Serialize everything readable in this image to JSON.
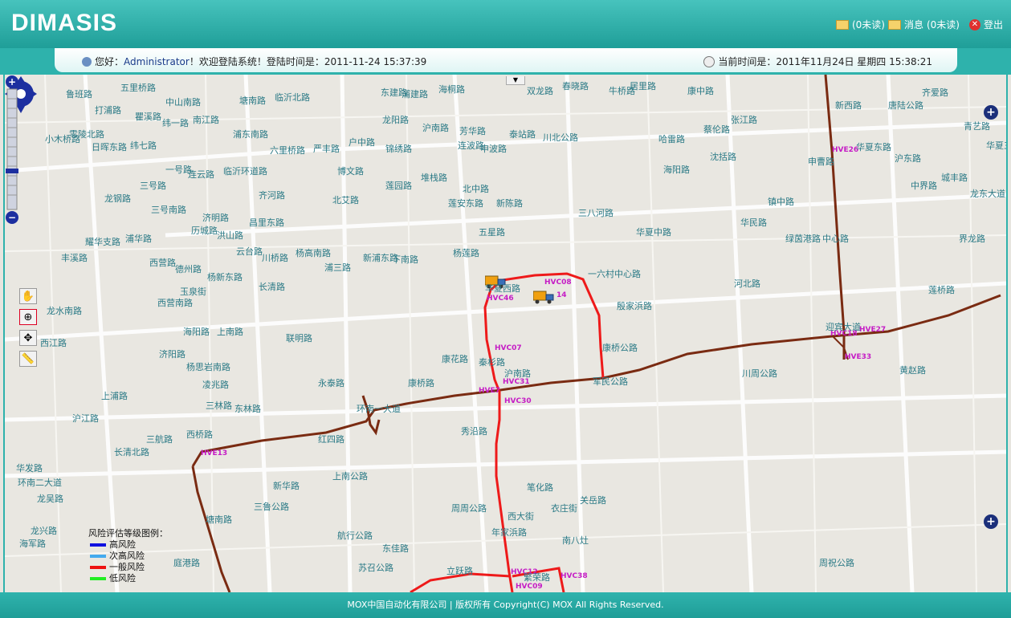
{
  "header": {
    "logo": "DIMASIS",
    "mail_unread": "(0未读)",
    "message_label": "消息",
    "message_unread": "(0未读)",
    "logout": "登出"
  },
  "info": {
    "greeting": "您好：",
    "user": "Administrator",
    "welcome": "！欢迎登陆系统！登陆时间是：",
    "login_time": "2011-11-24 15:37:39",
    "current_label": "当前时间是：",
    "current_time": "2011年11月24日 星期四 15:38:21"
  },
  "legend": {
    "title": "风险评估等级图例：",
    "items": [
      {
        "label": "高风险",
        "color": "#1010e0"
      },
      {
        "label": "次高风险",
        "color": "#44aaee"
      },
      {
        "label": "一般风险",
        "color": "#ee1111"
      },
      {
        "label": "低风险",
        "color": "#22ee22"
      }
    ]
  },
  "colors": {
    "route_brown": "#7a2b12",
    "route_red": "#ee1a1a",
    "station_pink": "#c51cc5"
  },
  "stations": {
    "s1": "HVC08",
    "s2": "HVC46",
    "s3": "14",
    "s4": "HVC07",
    "s5": "HVC31",
    "s6": "HVE7",
    "s7": "HVC30",
    "s8": "HVE26",
    "s9": "HVE27",
    "s10": "HVC18",
    "s11": "HVE33",
    "s12": "HVE13",
    "s13": "HVC12",
    "s14": "HVC38",
    "s15": "HVC09"
  },
  "roads": {
    "r1": "五里桥路",
    "r2": "中山南路",
    "r3": "纬一路",
    "r4": "南江路",
    "r5": "塘南路",
    "r6": "临沂北路",
    "r7": "浦建路",
    "r8": "龙阳路",
    "r9": "东建路",
    "r10": "海桐路",
    "r11": "芳华路",
    "r12": "春晓路",
    "r13": "双龙路",
    "r14": "牛桥路",
    "r15": "居里路",
    "r16": "康中路",
    "r17": "齐爱路",
    "r18": "新西路",
    "r19": "唐陆公路",
    "r20": "青艺路",
    "r21": "鲁班路",
    "r22": "打浦路",
    "r23": "瞿溪路",
    "r24": "纬七路",
    "r25": "浦东南路",
    "r26": "六里桥路",
    "r27": "严丰路",
    "r28": "户中路",
    "r29": "锦绣路",
    "r30": "沪南路",
    "r31": "连波路",
    "r32": "泰站路",
    "r33": "申波路",
    "r34": "川北公路",
    "r35": "哈雷路",
    "r36": "蔡伦路",
    "r37": "张江路",
    "r38": "华夏东路",
    "r39": "沪东路",
    "r40": "华夏三路",
    "r41": "日晖东路",
    "r42": "小木桥路",
    "r43": "零陵北路",
    "r44": "一号路",
    "r45": "连云路",
    "r46": "临沂环道路",
    "r47": "博文路",
    "r48": "沈括路",
    "r49": "海阳路",
    "r50": "申曹路",
    "r51": "城丰路",
    "r52": "中界路",
    "r53": "龙东大道",
    "r54": "三号路",
    "r55": "龙钢路",
    "r56": "三号南路",
    "r57": "济明路",
    "r58": "齐河路",
    "r59": "莲园路",
    "r60": "堆栈路",
    "r61": "北中路",
    "r62": "北艾路",
    "r63": "莲安东路",
    "r64": "新陈路",
    "r65": "镇中路",
    "r66": "华民路",
    "r67": "界龙路",
    "r68": "耀华支路",
    "r69": "浦华路",
    "r70": "历城路",
    "r71": "洪山路",
    "r72": "昌里东路",
    "r73": "三八河路",
    "r74": "华夏中路",
    "r75": "绿茵港路",
    "r76": "中心路",
    "r77": "云台路",
    "r78": "丰溪路",
    "r79": "西营路",
    "r80": "德州路",
    "r81": "杨新东路",
    "r82": "川桥路",
    "r83": "浦三路",
    "r84": "杨高南路",
    "r85": "新浦东路",
    "r86": "下南路",
    "r87": "杨莲路",
    "r88": "五星路",
    "r89": "华夏西路",
    "r90": "一六村中心路",
    "r91": "殷家浜路",
    "r92": "河北路",
    "r93": "莲桥路",
    "r94": "迎宾大道",
    "r95": "长清路",
    "r96": "玉泉街",
    "r97": "西营南路",
    "r98": "龙水南路",
    "r99": "海阳路",
    "r100": "联明路",
    "r101": "康桥公路",
    "r102": "黄赵路",
    "r103": "西江路",
    "r104": "上南路",
    "r105": "济阳路",
    "r106": "杨思岩南路",
    "r107": "康花路",
    "r108": "秦杉路",
    "r109": "沪南路",
    "r110": "川周公路",
    "r111": "永泰路",
    "r112": "凌兆路",
    "r113": "康桥路",
    "r114": "军民公路",
    "r115": "上浦路",
    "r116": "三林路",
    "r117": "东林路",
    "r118": "环南一大道",
    "r119": "沪江路",
    "r120": "三航路",
    "r121": "西桥路",
    "r122": "红四路",
    "r123": "秀沿路",
    "r124": "华发路",
    "r125": "环南二大道",
    "r126": "长清北路",
    "r127": "新华路",
    "r128": "上南公路",
    "r129": "笔化路",
    "r130": "关岳路",
    "r131": "周周公路",
    "r132": "西大街",
    "r133": "衣庄街",
    "r134": "龙吴路",
    "r135": "塘南路",
    "r136": "三鲁公路",
    "r137": "年家浜路",
    "r138": "东佳路",
    "r139": "南八灶",
    "r140": "龙兴路",
    "r141": "海军路",
    "r142": "周祝公路",
    "r143": "庭港路",
    "r144": "立跃路",
    "r145": "繁荣路",
    "r146": "苏召公路",
    "r147": "航行公路"
  },
  "footer": {
    "text": "MOX中国自动化有限公司 | 版权所有 Copyright(C) MOX All Rights Reserved."
  }
}
